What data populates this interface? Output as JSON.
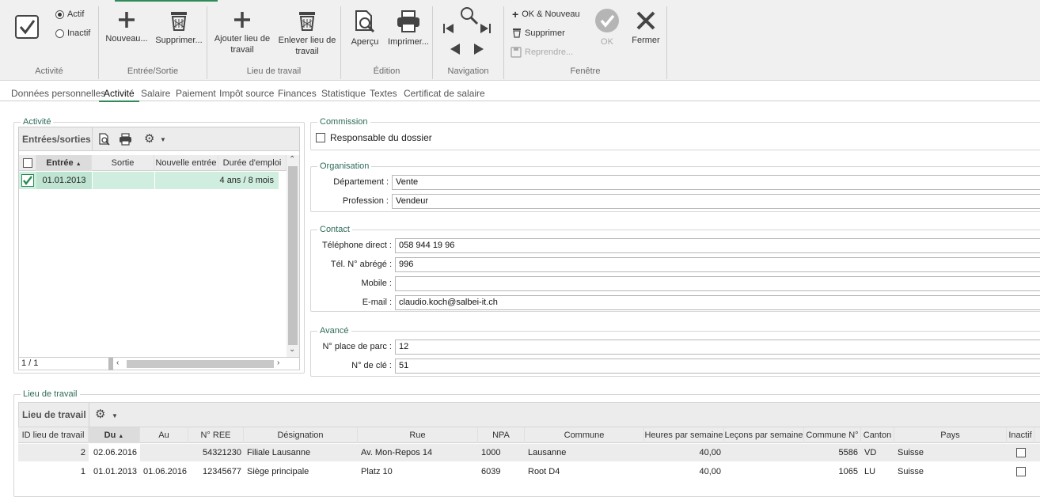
{
  "ribbon": {
    "activite": {
      "label": "Activité",
      "actif": "Actif",
      "inactif": "Inactif"
    },
    "entree_sortie": {
      "label": "Entrée/Sortie",
      "nouveau": "Nouveau...",
      "supprimer": "Supprimer..."
    },
    "lieu": {
      "label": "Lieu de travail",
      "ajouter": "Ajouter lieu de travail",
      "enlever": "Enlever lieu de travail"
    },
    "edition": {
      "label": "Édition",
      "apercu": "Aperçu",
      "imprimer": "Imprimer..."
    },
    "navigation": {
      "label": "Navigation"
    },
    "fenetre": {
      "label": "Fenêtre",
      "ok_nouveau": "OK & Nouveau",
      "supprimer": "Supprimer",
      "reprendre": "Reprendre...",
      "ok": "OK",
      "fermer": "Fermer"
    }
  },
  "tabs": [
    "Données personnelles",
    "Activité",
    "Salaire",
    "Paiement",
    "Impôt source",
    "Finances",
    "Statistique",
    "Textes",
    "Certificat de salaire"
  ],
  "activite": {
    "legend": "Activité",
    "toolbar_title": "Entrées/sorties",
    "columns": [
      "Entrée",
      "Sortie",
      "Nouvelle entrée",
      "Durée d'emploi"
    ],
    "rows": [
      {
        "entree": "01.01.2013",
        "sortie": "",
        "nouvelle": "",
        "duree": "4 ans / 8 mois"
      }
    ],
    "pager": "1 / 1"
  },
  "commission": {
    "legend": "Commission",
    "responsable": "Responsable du dossier"
  },
  "organisation": {
    "legend": "Organisation",
    "departement_label": "Département :",
    "departement": "Vente",
    "profession_label": "Profession :",
    "profession": "Vendeur"
  },
  "contact": {
    "legend": "Contact",
    "tel_label": "Téléphone direct :",
    "tel": "058 944 19 96",
    "abrege_label": "Tél. N° abrégé :",
    "abrege": "996",
    "mobile_label": "Mobile :",
    "mobile": "",
    "email_label": "E-mail :",
    "email": "claudio.koch@salbei-it.ch"
  },
  "avance": {
    "legend": "Avancé",
    "parc_label": "N° place de parc :",
    "parc": "12",
    "cle_label": "N° de clé :",
    "cle": "51"
  },
  "lieu": {
    "legend": "Lieu de travail",
    "toolbar_title": "Lieu de travail",
    "columns": [
      "ID lieu de travail",
      "Du",
      "Au",
      "N° REE",
      "Désignation",
      "Rue",
      "NPA",
      "Commune",
      "Heures par semaine",
      "Leçons par semaine",
      "Commune N°",
      "Canton",
      "Pays",
      "Inactif"
    ],
    "rows": [
      {
        "id": "2",
        "du": "02.06.2016",
        "au": "",
        "ree": "54321230",
        "designation": "Filiale Lausanne",
        "rue": "Av. Mon-Repos 14",
        "npa": "1000",
        "commune": "Lausanne",
        "heures": "40,00",
        "lecons": "",
        "communeno": "5586",
        "canton": "VD",
        "pays": "Suisse"
      },
      {
        "id": "1",
        "du": "01.01.2013",
        "au": "01.06.2016",
        "ree": "12345677",
        "designation": "Siège principale",
        "rue": "Platz 10",
        "npa": "6039",
        "commune": "Root D4",
        "heures": "40,00",
        "lecons": "",
        "communeno": "1065",
        "canton": "LU",
        "pays": "Suisse"
      }
    ]
  }
}
